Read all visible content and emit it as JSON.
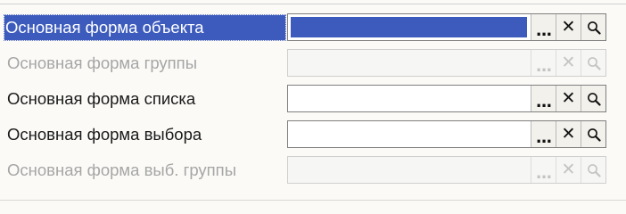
{
  "form": {
    "rows": [
      {
        "label": "Основная форма объекта",
        "selected": true,
        "enabled": true
      },
      {
        "label": "Основная форма группы",
        "selected": false,
        "enabled": false
      },
      {
        "label": "Основная форма списка",
        "selected": false,
        "enabled": true
      },
      {
        "label": "Основная форма выбора",
        "selected": false,
        "enabled": true
      },
      {
        "label": "Основная форма выб. группы",
        "selected": false,
        "enabled": false
      }
    ],
    "buttons": {
      "select": "...",
      "clear": "✕",
      "open_icon": "magnifier-icon"
    }
  },
  "colors": {
    "selection": "#3c5bbd",
    "disabled_text": "#a6a6a6",
    "background": "#fbfaf7"
  }
}
